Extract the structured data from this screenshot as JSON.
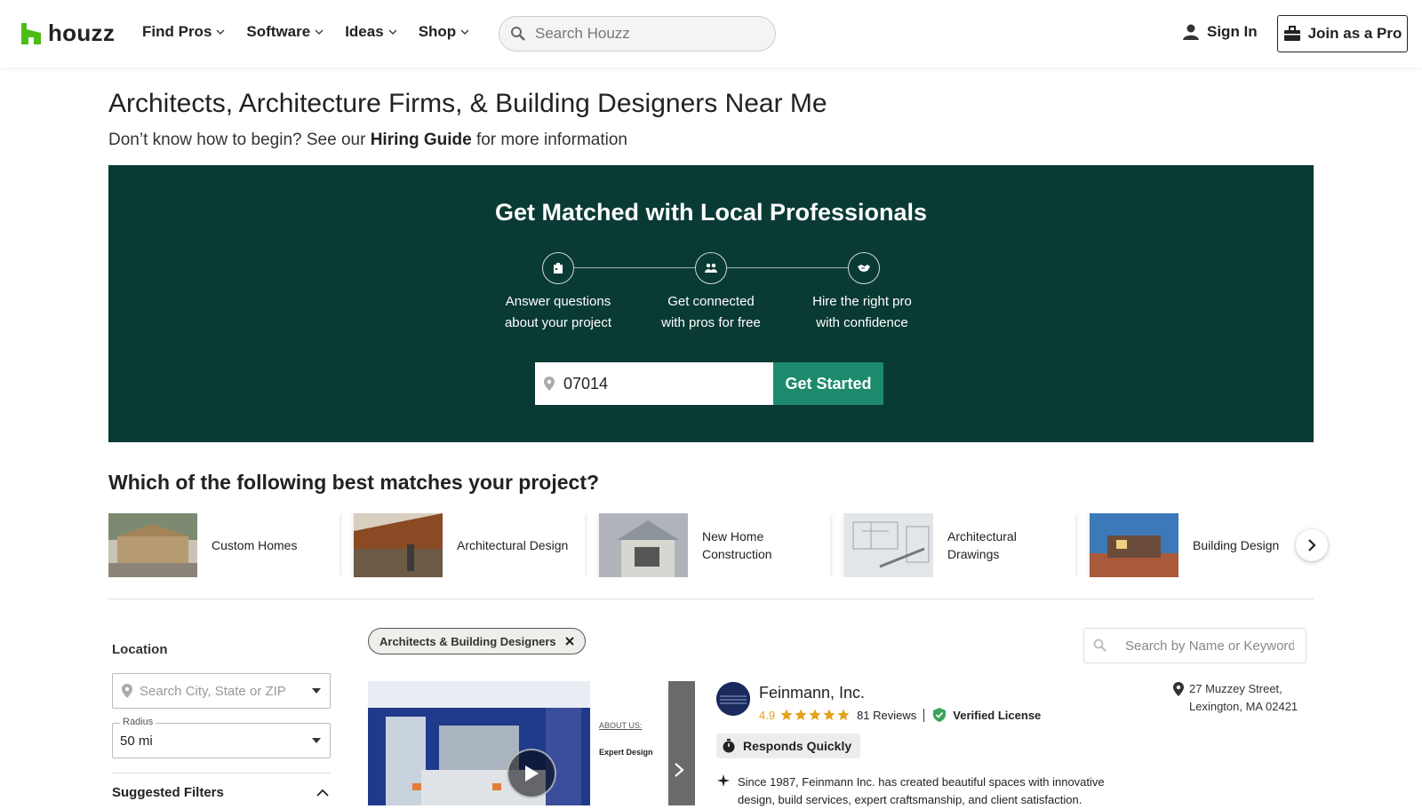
{
  "header": {
    "logo_text": "houzz",
    "brand_color": "#4dbc15",
    "nav": [
      {
        "label": "Find Pros"
      },
      {
        "label": "Software"
      },
      {
        "label": "Ideas"
      },
      {
        "label": "Shop"
      }
    ],
    "search_placeholder": "Search Houzz",
    "sign_in": "Sign In",
    "join_pro": "Join as a Pro"
  },
  "page": {
    "title": "Architects, Architecture Firms, & Building Designers Near Me",
    "subtitle_pre": "Don’t know how to begin? See our ",
    "subtitle_link": "Hiring Guide",
    "subtitle_post": " for more information"
  },
  "match": {
    "title": "Get Matched with Local Professionals",
    "bg_color": "#0a3a34",
    "steps": [
      {
        "icon": "clipboard-icon",
        "line1": "Answer questions",
        "line2": "about your project"
      },
      {
        "icon": "people-icon",
        "line1": "Get connected",
        "line2": "with pros for free"
      },
      {
        "icon": "handshake-icon",
        "line1": "Hire the right pro",
        "line2": "with confidence"
      }
    ],
    "zip_value": "07014",
    "cta": "Get Started",
    "cta_color": "#1d8a6e"
  },
  "categories": {
    "heading": "Which of the following best matches your project?",
    "items": [
      {
        "label": "Custom Homes"
      },
      {
        "label": "Architectural Design"
      },
      {
        "label": "New Home Construction"
      },
      {
        "label": "Architectural Drawings"
      },
      {
        "label": "Building Design"
      }
    ]
  },
  "filters": {
    "location_label": "Location",
    "location_placeholder": "Search City, State or ZIP",
    "radius_label": "Radius",
    "radius_value": "50 mi",
    "suggested_label": "Suggested Filters"
  },
  "results": {
    "chip": "Architects & Building Designers",
    "keyword_placeholder": "Search by Name or Keyword",
    "pro": {
      "name": "Feinmann, Inc.",
      "rating": "4.9",
      "stars": 5,
      "reviews": "81 Reviews",
      "verified": "Verified License",
      "badge": "Responds Quickly",
      "description": "Since 1987, Feinmann Inc. has created beautiful spaces with innovative design, build services, expert craftsmanship, and client satisfaction.",
      "address_line1": "27 Muzzey Street,",
      "address_line2": "Lexington, MA 02421",
      "photo_caption_1": "ABOUT US:",
      "photo_caption_2": "Expert Design"
    }
  }
}
